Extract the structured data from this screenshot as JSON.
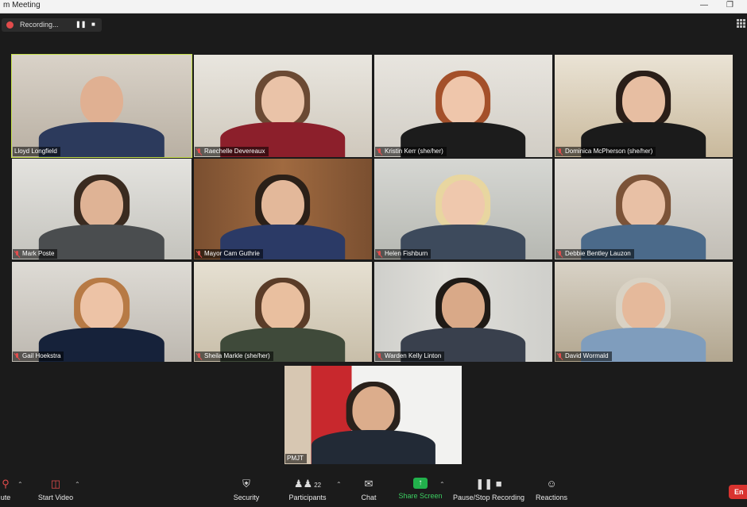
{
  "window": {
    "title": "m Meeting",
    "minimize_icon": "minimize-icon",
    "restore_icon": "restore-icon"
  },
  "recording": {
    "label": "Recording...",
    "pause_icon": "pause-icon",
    "stop_icon": "stop-icon"
  },
  "participants": [
    {
      "name": "Lloyd Longfield",
      "muted": false,
      "active_speaker": true
    },
    {
      "name": "Raechelle Devereaux",
      "muted": true,
      "active_speaker": false
    },
    {
      "name": "Kristin Kerr (she/her)",
      "muted": true,
      "active_speaker": false
    },
    {
      "name": "Dominica McPherson (she/her)",
      "muted": true,
      "active_speaker": false
    },
    {
      "name": "Mark Poste",
      "muted": true,
      "active_speaker": false
    },
    {
      "name": "Mayor Cam Guthrie",
      "muted": true,
      "active_speaker": false
    },
    {
      "name": "Helen Fishburn",
      "muted": true,
      "active_speaker": false
    },
    {
      "name": "Debbie Bentley Lauzon",
      "muted": true,
      "active_speaker": false
    },
    {
      "name": "Gail Hoekstra",
      "muted": true,
      "active_speaker": false
    },
    {
      "name": "Sheila Markle (she/her)",
      "muted": true,
      "active_speaker": false
    },
    {
      "name": "Warden Kelly Linton",
      "muted": true,
      "active_speaker": false
    },
    {
      "name": "David Wormald",
      "muted": true,
      "active_speaker": false
    },
    {
      "name": "PMJT",
      "muted": false,
      "active_speaker": false
    }
  ],
  "toolbar": {
    "mute_label": "ute",
    "start_video_label": "Start Video",
    "security_label": "Security",
    "participants_label": "Participants",
    "participants_count": "22",
    "chat_label": "Chat",
    "share_screen_label": "Share Screen",
    "recording_label": "Pause/Stop Recording",
    "reactions_label": "Reactions",
    "end_label": "En"
  },
  "colors": {
    "active_speaker_border": "#c6e04a",
    "share_green": "#22b14c",
    "end_red": "#d9332f",
    "muted_red": "#e34c4c"
  }
}
